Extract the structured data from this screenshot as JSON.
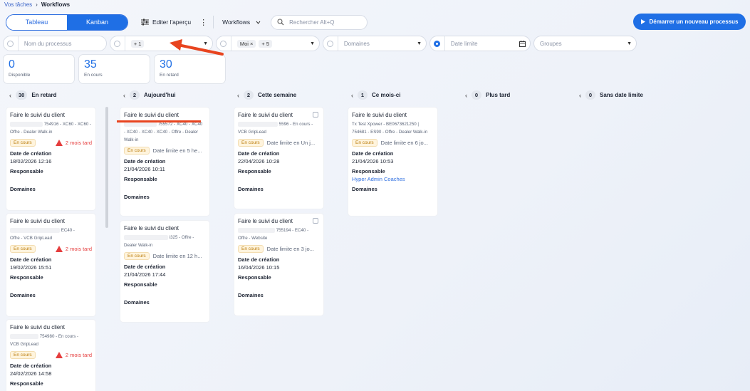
{
  "breadcrumb": {
    "parent": "Vos tâches",
    "sep": "›",
    "current": "Workflows"
  },
  "toolbar": {
    "tab_tableau": "Tableau",
    "tab_kanban": "Kanban",
    "edit_view": "Editer l'aperçu",
    "more": "⋮",
    "workflows": "Workflows",
    "search_placeholder": "Rechercher Alt+Q",
    "start_button": "Démarrer un nouveau processus"
  },
  "filters": {
    "process_name": "Nom du processus",
    "plus_one": "+ 1",
    "moi": "Moi",
    "moi_remove": "×",
    "plus_five": "+ 5",
    "domaines": "Domaines",
    "date_limite": "Date limite",
    "groupes": "Groupes"
  },
  "stats": [
    {
      "num": "0",
      "label": "Disponible"
    },
    {
      "num": "35",
      "label": "En cours"
    },
    {
      "num": "30",
      "label": "En retard"
    }
  ],
  "columns": [
    {
      "count": "30",
      "label": "En retard"
    },
    {
      "count": "2",
      "label": "Aujourd'hui"
    },
    {
      "count": "2",
      "label": "Cette semaine"
    },
    {
      "count": "1",
      "label": "Ce mois-ci"
    },
    {
      "count": "0",
      "label": "Plus tard"
    },
    {
      "count": "0",
      "label": "Sans date limite"
    }
  ],
  "labels": {
    "date_creation": "Date de création",
    "responsable": "Responsable",
    "domaines": "Domaines",
    "status": "En cours",
    "late": "2 mois tard"
  },
  "cards": {
    "c1": {
      "title": "Faire le suivi du client",
      "sub1": "754916 - XC60 - XC60 -",
      "sub2": "Offre - Dealer Walk-in",
      "date": "18/02/2026 12:16"
    },
    "c2": {
      "title": "Faire le suivi du client",
      "sub1": "EC40 -",
      "sub2": "Offre - VCB GripLead",
      "date": "19/02/2026 15:51"
    },
    "c3": {
      "title": "Faire le suivi du client",
      "sub1": "754980 - En cours -",
      "sub2": "VCB GripLead",
      "date": "24/02/2026 14:58"
    },
    "c4": {
      "title": "Faire le suivi du client",
      "sub1": "755572 - XC40 - XC40",
      "sub2": "- XC40 - XC40 - XC40 - Offre - Dealer",
      "sub3": "Walk-in",
      "deadline": "Date limite en 5 he...",
      "date": "21/04/2026 10:11"
    },
    "c5": {
      "title": "Faire le suivi du client",
      "sub1": "i325 - Offre -",
      "sub2": "Dealer Walk-in",
      "deadline": "Date limite en 12 h...",
      "date": "21/04/2026 17:44"
    },
    "c6": {
      "title": "Faire le suivi du client",
      "sub1": "5596 - En cours -",
      "sub2": "VCB GripLead",
      "deadline": "Date limite en Un j...",
      "date": "22/04/2026 10:28"
    },
    "c7": {
      "title": "Faire le suivi du client",
      "sub1": "755194 - EC40 -",
      "sub2": "Offre - Website",
      "deadline": "Date limite en 3 jo...",
      "date": "16/04/2026 10:15"
    },
    "c8": {
      "title": "Faire le suivi du client",
      "sub1": "Tx Test Xpower - BE0673621250 |",
      "sub2": "754681 - ES90 - Offre - Dealer Walk-in",
      "deadline": "Date limite en 6 jo...",
      "date": "21/04/2026 10:53",
      "responsable": "Hyper Admin Coaches"
    }
  },
  "colors": {
    "accent": "#1f6fe5",
    "late": "#e53d3d",
    "annotation": "#e8441f"
  }
}
